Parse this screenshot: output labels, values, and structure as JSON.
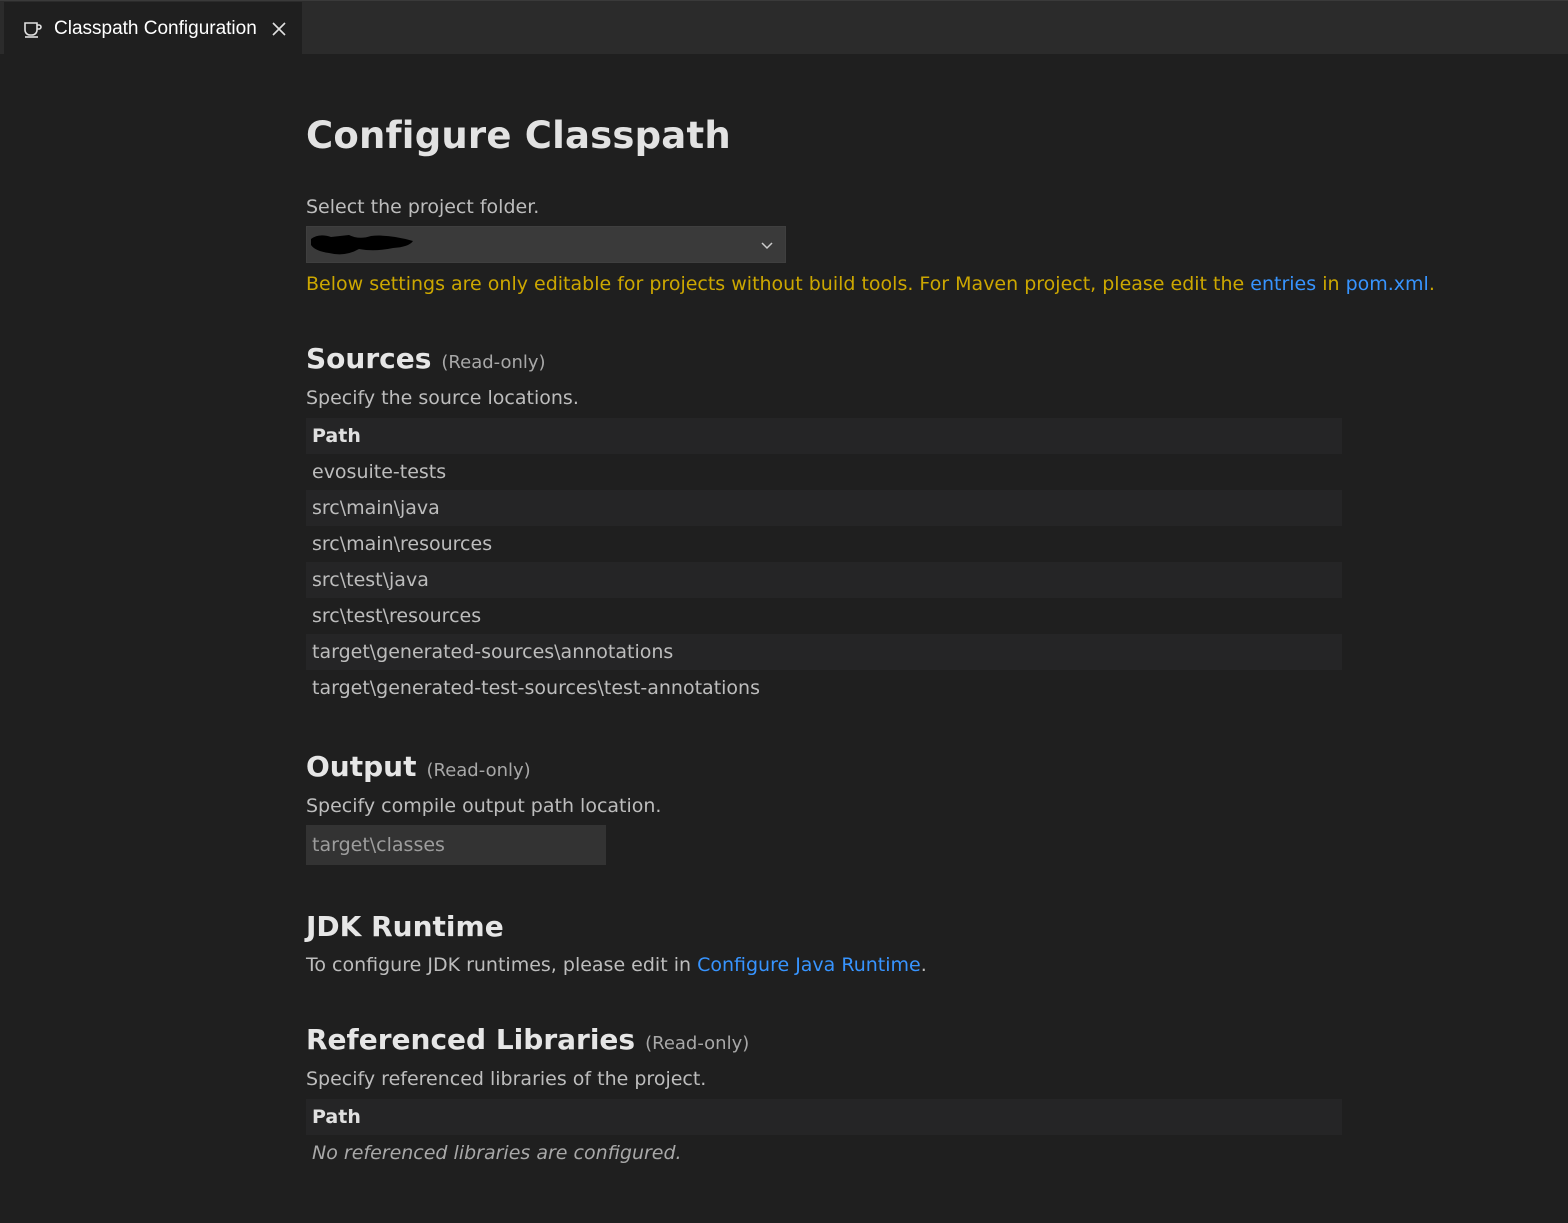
{
  "tab": {
    "label": "Classpath Configuration",
    "icon": "coffee-cup-icon"
  },
  "page": {
    "title": "Configure Classpath",
    "select_label": "Select the project folder.",
    "warning": {
      "prefix": "Below settings are only editable for projects without build tools. For Maven project, please edit the ",
      "link1": "entries",
      "middle": " in ",
      "link2": "pom.xml",
      "suffix": "."
    }
  },
  "sources": {
    "title": "Sources",
    "tag": "(Read-only)",
    "description": "Specify the source locations.",
    "column": "Path",
    "rows": [
      "evosuite-tests",
      "src\\main\\java",
      "src\\main\\resources",
      "src\\test\\java",
      "src\\test\\resources",
      "target\\generated-sources\\annotations",
      "target\\generated-test-sources\\test-annotations"
    ]
  },
  "output": {
    "title": "Output",
    "tag": "(Read-only)",
    "description": "Specify compile output path location.",
    "value": "target\\classes"
  },
  "jdk": {
    "title": "JDK Runtime",
    "prefix": "To configure JDK runtimes, please edit in ",
    "link": "Configure Java Runtime",
    "suffix": "."
  },
  "libraries": {
    "title": "Referenced Libraries",
    "tag": "(Read-only)",
    "description": "Specify referenced libraries of the project.",
    "column": "Path",
    "empty": "No referenced libraries are configured."
  },
  "colors": {
    "background": "#1f1f1f",
    "tabbar": "#2b2b2b",
    "warning": "#cca700",
    "link": "#3794ff"
  }
}
